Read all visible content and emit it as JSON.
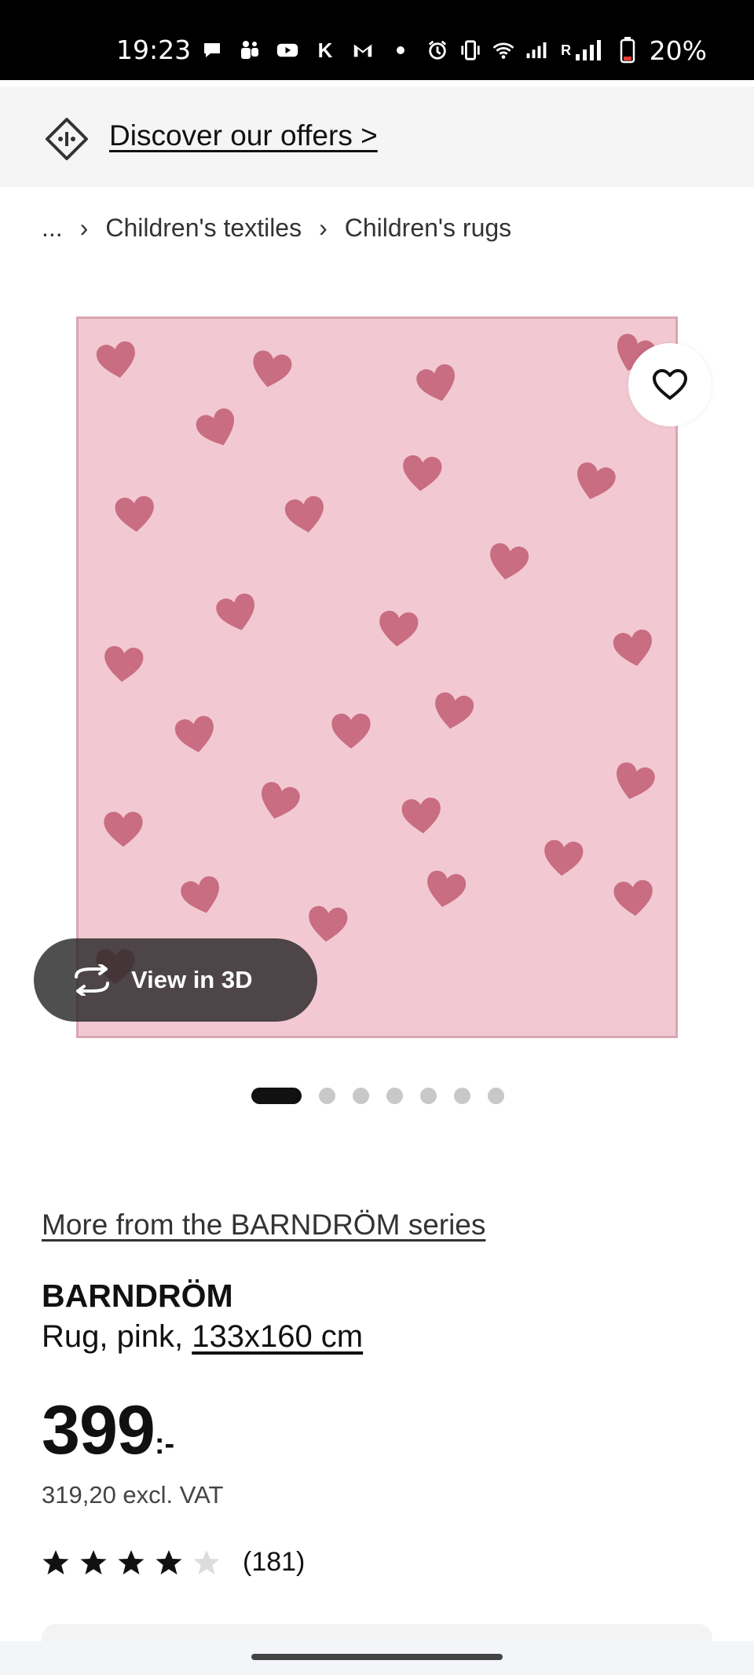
{
  "status_bar": {
    "time": "19:23",
    "battery": "20%",
    "left_icons": [
      "chat-icon",
      "teams-icon",
      "youtube-icon",
      "k-icon",
      "gmail-icon",
      "dot-icon"
    ],
    "right_icons": [
      "alarm-icon",
      "vibrate-icon",
      "wifi-icon",
      "signal-icon",
      "signal-r-icon",
      "battery-icon"
    ],
    "k_letter": "K",
    "r_letter": "R"
  },
  "banner": {
    "label": "Discover our offers >",
    "icon": "price-tag-icon"
  },
  "breadcrumb": {
    "items": [
      "...",
      "Children's textiles",
      "Children's rugs"
    ],
    "separator": "›"
  },
  "gallery": {
    "view_3d_label": "View in 3D",
    "total_images": 7,
    "active_index": 0,
    "rug_color": "#f2c9d2",
    "heart_color": "#c96d82"
  },
  "product": {
    "series_link": "More from the BARNDRÖM series",
    "name": "BARNDRÖM",
    "description": "Rug, pink, ",
    "size": "133x160 cm",
    "price": "399",
    "price_suffix": ":-",
    "price_excl_vat": "319,20 excl. VAT",
    "rating_stars": 4,
    "rating_max": 5,
    "review_count": "(181)"
  }
}
